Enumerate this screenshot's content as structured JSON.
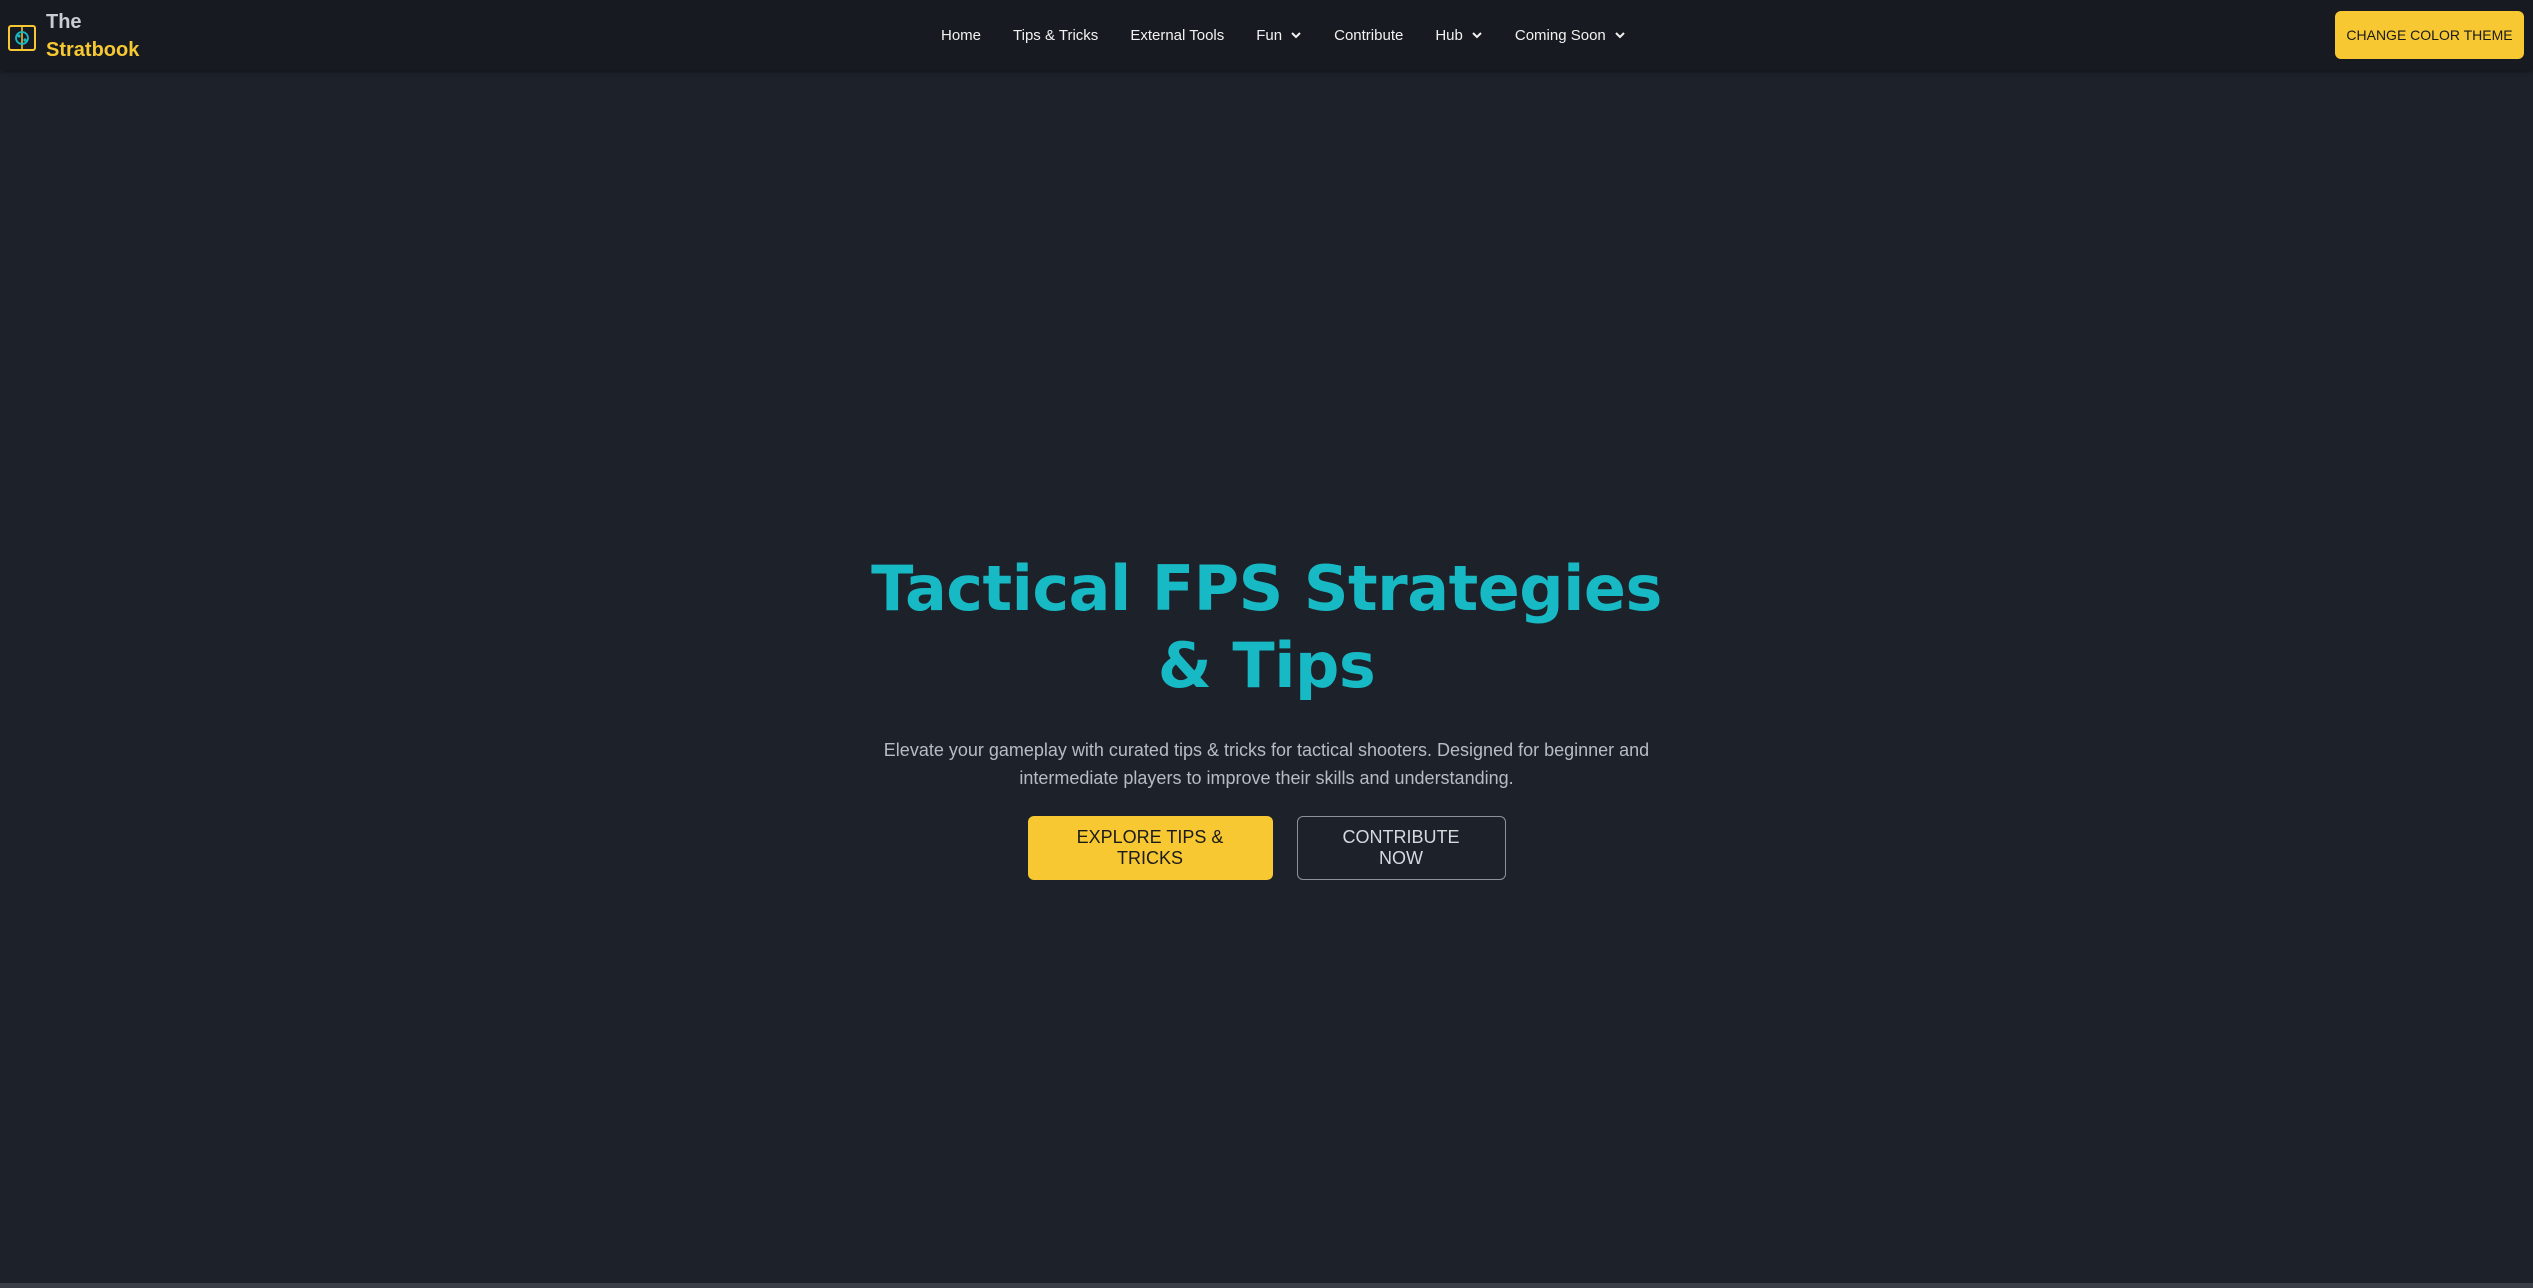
{
  "brand": {
    "line1": "The",
    "line2": "Stratbook",
    "logo_icon": "book-brain-icon"
  },
  "nav": {
    "items": [
      {
        "label": "Home",
        "dropdown": false
      },
      {
        "label": "Tips & Tricks",
        "dropdown": false
      },
      {
        "label": "External Tools",
        "dropdown": false
      },
      {
        "label": "Fun",
        "dropdown": true
      },
      {
        "label": "Contribute",
        "dropdown": false
      },
      {
        "label": "Hub",
        "dropdown": true
      },
      {
        "label": "Coming Soon",
        "dropdown": true
      }
    ],
    "theme_button": "CHANGE COLOR THEME"
  },
  "hero": {
    "title": "Tactical FPS Strategies & Tips",
    "subtitle": "Elevate your gameplay with curated tips & tricks for tactical shooters. Designed for beginner and intermediate players to improve their skills and understanding.",
    "primary_cta": "EXPLORE TIPS & TRICKS",
    "secondary_cta": "CONTRIBUTE NOW"
  },
  "colors": {
    "background": "#1d222a",
    "navbar": "#171b21",
    "accent_yellow": "#f7c832",
    "title_teal": "#17b9c4"
  }
}
